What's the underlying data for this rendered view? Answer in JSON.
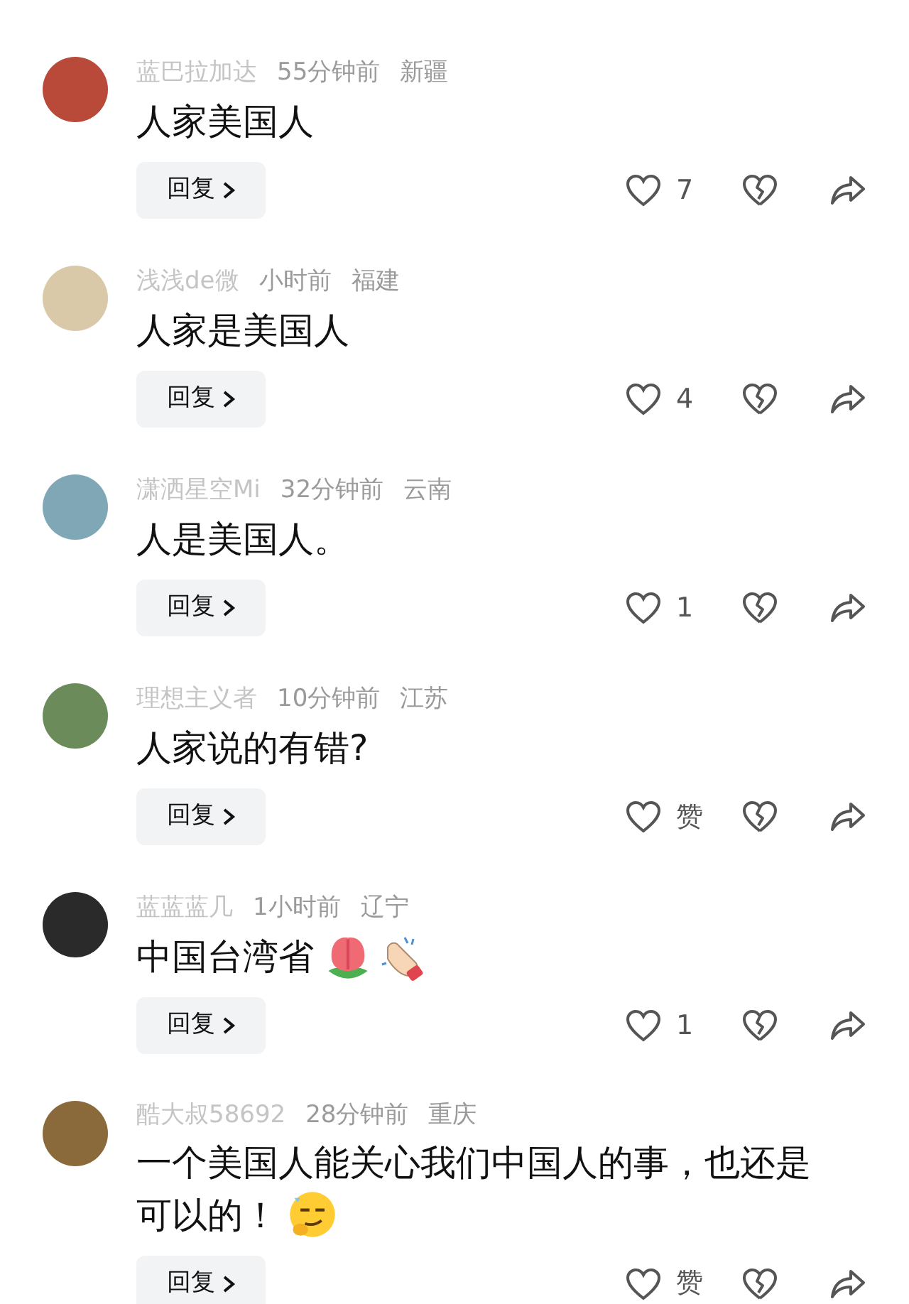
{
  "comments": [
    {
      "username": "蓝巴拉加达",
      "time": "55分钟前",
      "region": "新疆",
      "lines": [
        "人家美国人"
      ],
      "reply": "回复",
      "likes": "7"
    },
    {
      "username": "浅浅de微",
      "time": "小时前",
      "region": "福建",
      "lines": [
        "人家是美国人"
      ],
      "reply": "回复",
      "likes": "4"
    },
    {
      "username": "潇洒星空Mi",
      "time": "32分钟前",
      "region": "云南",
      "lines": [
        "人是美国人。"
      ],
      "reply": "回复",
      "likes": "1"
    },
    {
      "username": "理想主义者",
      "time": "10分钟前",
      "region": "江苏",
      "lines": [
        "人家说的有错?"
      ],
      "reply": "回复",
      "likes": "赞"
    },
    {
      "username": "蓝蓝蓝几",
      "time": "1小时前",
      "region": "辽宁",
      "lines": [
        "中国台湾省"
      ],
      "emojis": [
        {
          "kind": "flower"
        },
        {
          "kind": "clap"
        }
      ],
      "reply": "回复",
      "likes": "1"
    },
    {
      "username": "酷大叔58692",
      "time": "28分钟前",
      "region": "重庆",
      "lines": [
        "一个美国人能关心我们中国人的事，也还是",
        "可以的！"
      ],
      "emojis": [
        {
          "kind": "smirk"
        }
      ],
      "reply": "回复",
      "likes": "赞"
    }
  ]
}
